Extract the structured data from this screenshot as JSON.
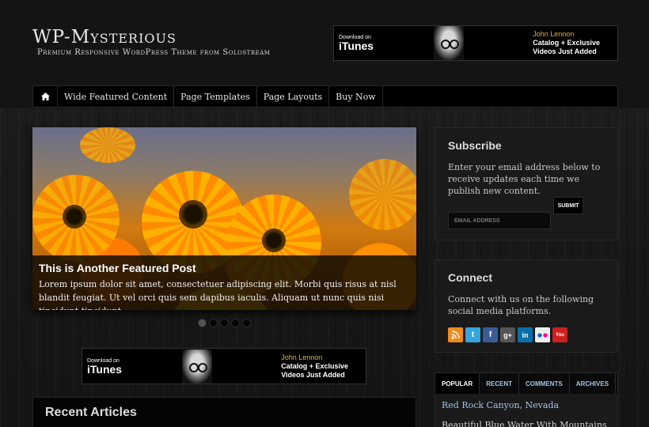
{
  "header": {
    "site_title": "WP-Mysterious",
    "tagline": "Premium Responsive WordPress Theme from Solostream"
  },
  "banner": {
    "download_on": "Download on",
    "store": "iTunes",
    "artist": "John Lennon",
    "line1": "Catalog + Exclusive",
    "line2": "Videos Just Added"
  },
  "nav": {
    "home_icon": "home-icon",
    "items": [
      "Wide Featured Content",
      "Page Templates",
      "Page Layouts",
      "Buy Now"
    ]
  },
  "featured": {
    "title": "This is Another Featured Post",
    "excerpt": "Lorem ipsum dolor sit amet, consectetuer adipiscing elit. Morbi quis risus at nisl blandit feugiat. Ut vel orci quis sem dapibus iaculis. Aliquam ut nunc quis nisi tincidunt tincidunt.",
    "slide_count": 5,
    "active_slide": 1
  },
  "recent": {
    "title": "Recent Articles"
  },
  "subscribe": {
    "title": "Subscribe",
    "text": "Enter your email address below to receive updates each time we publish new content.",
    "email_placeholder": "EMAIL ADDRESS",
    "submit_label": "SUBMIT"
  },
  "connect": {
    "title": "Connect",
    "text": "Connect with us on the following social media platforms.",
    "icons": [
      {
        "name": "rss-icon",
        "color": "#f28a1e",
        "glyph": "◉"
      },
      {
        "name": "twitter-icon",
        "color": "#33a6dd",
        "glyph": "t"
      },
      {
        "name": "facebook-icon",
        "color": "#3b5b98",
        "glyph": "f"
      },
      {
        "name": "google-plus-icon",
        "color": "#555555",
        "glyph": "g+"
      },
      {
        "name": "linkedin-icon",
        "color": "#0b6fa8",
        "glyph": "in"
      },
      {
        "name": "flickr-icon",
        "color": "#eeeeee",
        "glyph": "●●"
      },
      {
        "name": "youtube-icon",
        "color": "#cc1f1f",
        "glyph": "You"
      }
    ]
  },
  "tabs": {
    "items": [
      "POPULAR",
      "RECENT",
      "COMMENTS",
      "ARCHIVES"
    ],
    "active": "POPULAR",
    "first_link": "Red Rock Canyon, Nevada",
    "second_link": "Beautiful Blue Water With Mountains"
  }
}
